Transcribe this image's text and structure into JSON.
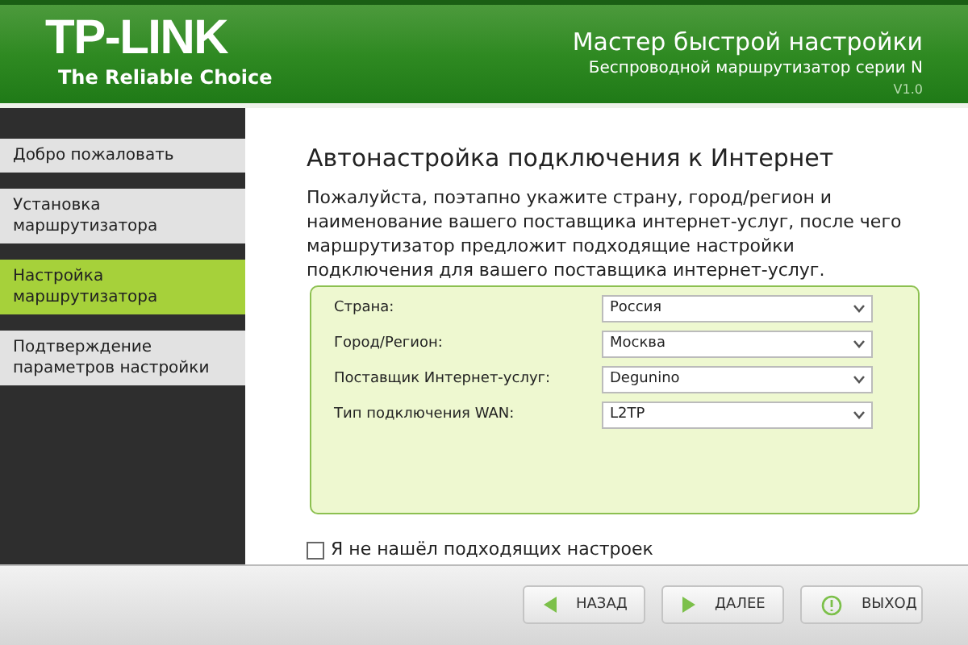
{
  "header": {
    "logo": "TP-LINK",
    "tagline": "The Reliable Choice",
    "title": "Мастер быстрой настройки",
    "subtitle": "Беспроводной маршрутизатор серии N",
    "version": "V1.0"
  },
  "sidebar": {
    "items": [
      {
        "label": "Добро пожаловать",
        "selected": false
      },
      {
        "label": "Установка маршрутизатора",
        "selected": false
      },
      {
        "label": "Настройка маршрутизатора",
        "selected": true
      },
      {
        "label": "Подтверждение параметров настройки",
        "selected": false
      }
    ]
  },
  "main": {
    "title": "Автонастройка подключения к Интернет",
    "description": "Пожалуйста, поэтапно укажите страну, город/регион и наименование вашего поставщика интернет-услуг, после чего маршрутизатор предложит подходящие настройки подключения для вашего поставщика интернет-услуг.",
    "fields": [
      {
        "label": "Страна:",
        "value": "Россия"
      },
      {
        "label": "Город/Регион:",
        "value": "Москва"
      },
      {
        "label": "Поставщик Интернет-услуг:",
        "value": "Degunino"
      },
      {
        "label": "Тип подключения WAN:",
        "value": "L2TP"
      }
    ],
    "checkbox": {
      "label": "Я не нашёл подходящих настроек",
      "checked": false
    }
  },
  "buttons": [
    {
      "kind": "back",
      "label": "НАЗАД"
    },
    {
      "kind": "next",
      "label": "ДАЛЕЕ"
    },
    {
      "kind": "exit",
      "label": "ВЫХОД"
    }
  ]
}
